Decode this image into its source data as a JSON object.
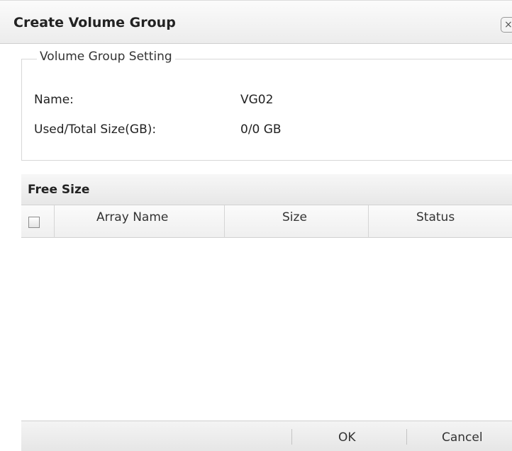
{
  "dialog": {
    "title": "Create Volume Group",
    "close_glyph": "×"
  },
  "volume_group_setting": {
    "legend": "Volume Group Setting",
    "name_label": "Name:",
    "name_value": "VG02",
    "size_label": "Used/Total Size(GB):",
    "size_value": "0/0 GB"
  },
  "free_size": {
    "title": "Free Size",
    "columns": [
      "Array Name",
      "Size",
      "Status"
    ],
    "rows": []
  },
  "footer": {
    "ok_label": "OK",
    "cancel_label": "Cancel"
  },
  "icons": {
    "close": "close-icon",
    "select_all": "checkbox-icon"
  }
}
